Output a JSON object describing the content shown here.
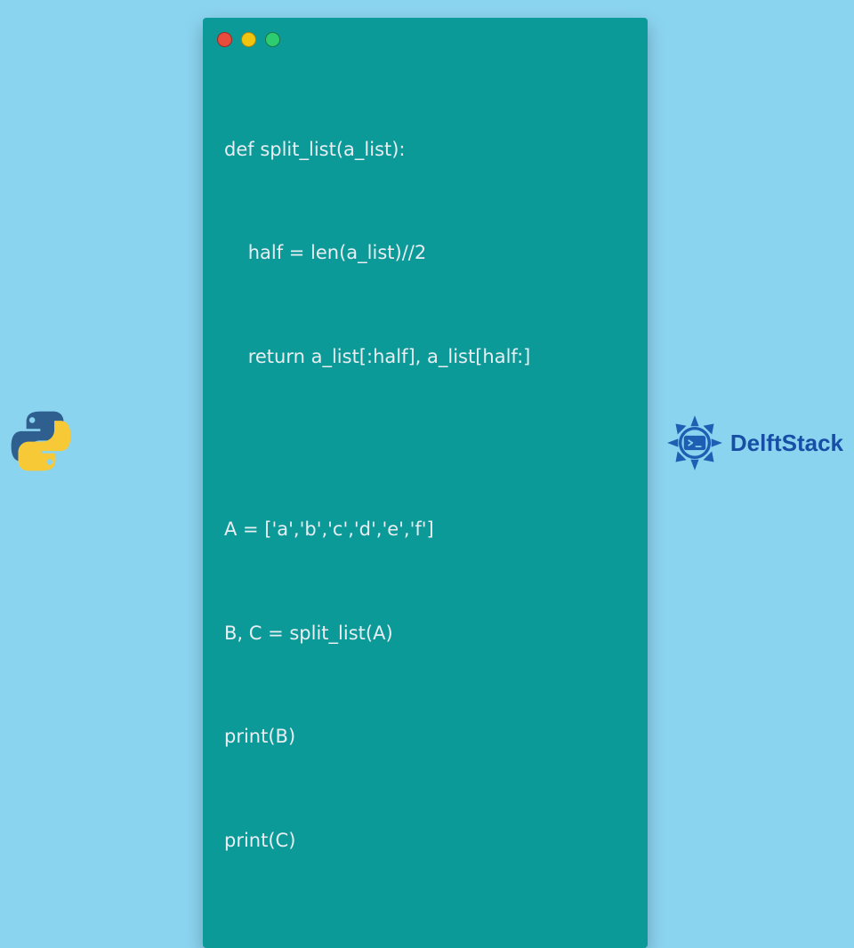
{
  "code": {
    "lines": [
      "def split_list(a_list):",
      "    half = len(a_list)//2",
      "    return a_list[:half], a_list[half:]",
      "",
      "A = ['a','b','c','d','e','f']",
      "B, C = split_list(A)",
      "print(B)",
      "print(C)"
    ]
  },
  "brand": {
    "name": "DelftStack"
  },
  "colors": {
    "page_bg": "#8bd4f0",
    "window_bg": "#0b9a98",
    "code_text": "#e8eef2",
    "brand_text": "#164fa5",
    "dot_red": "#e74c3c",
    "dot_yellow": "#f1c40f",
    "dot_green": "#2ecc71",
    "python_blue": "#2f5f8f",
    "python_yellow": "#f7c936"
  }
}
